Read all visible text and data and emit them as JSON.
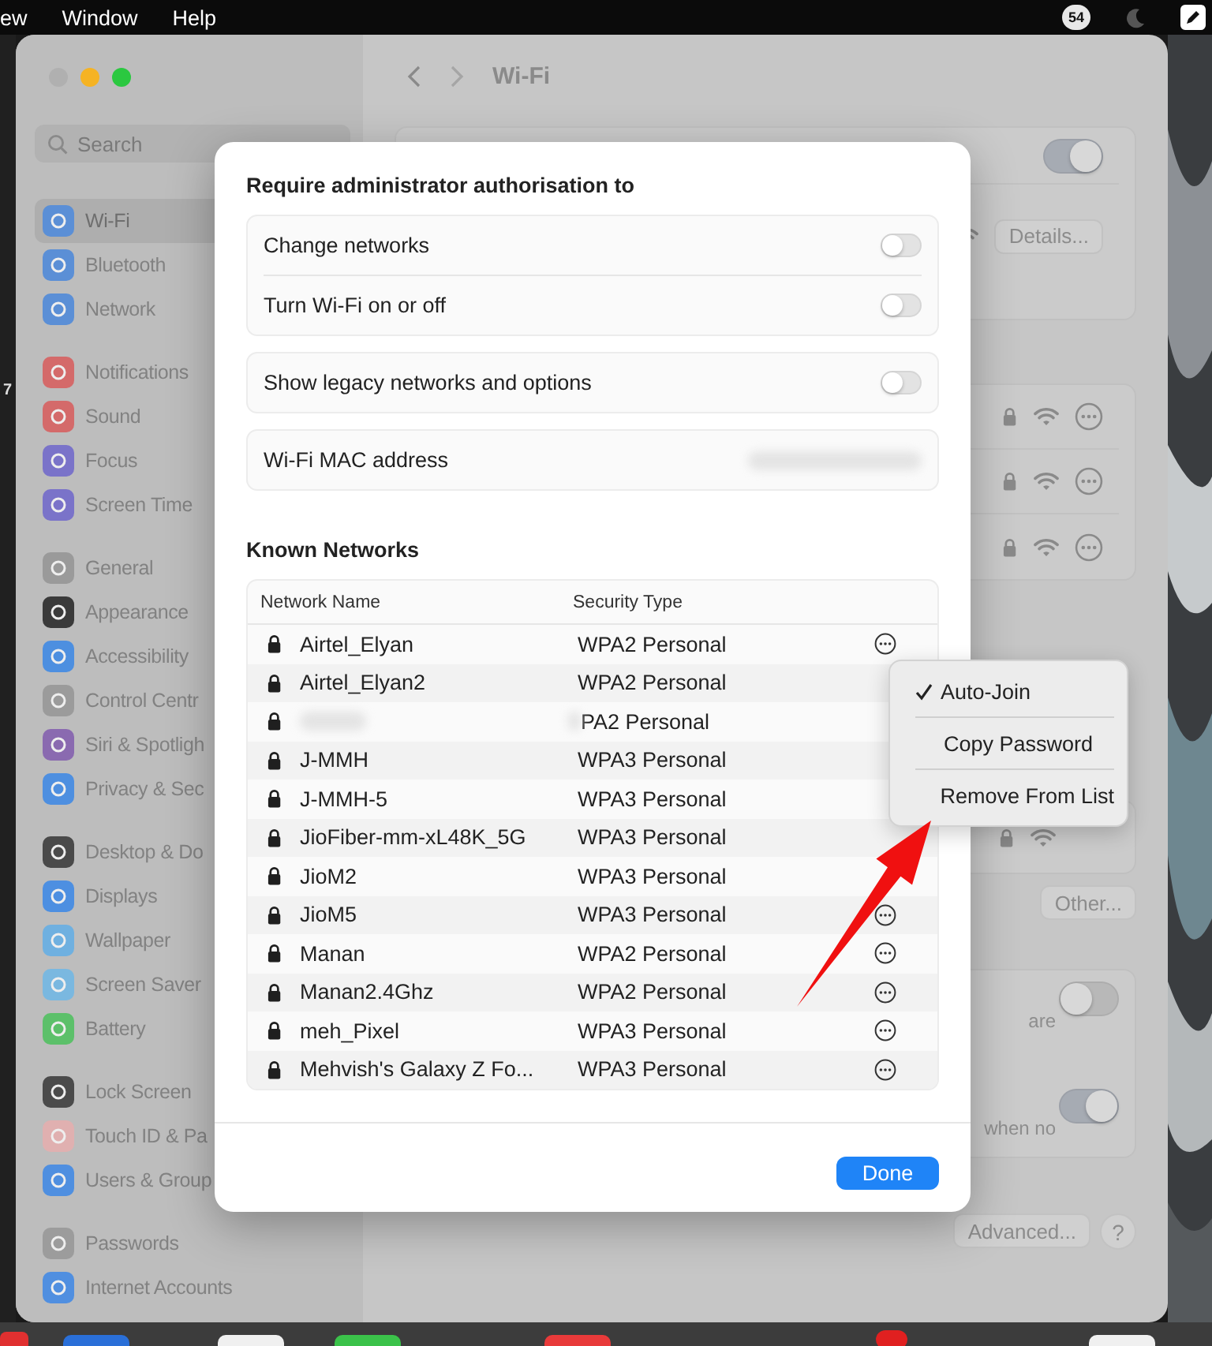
{
  "menu_bar": {
    "items": [
      "ew",
      "Window",
      "Help"
    ],
    "notification_count": "54"
  },
  "desktop": {
    "edge_text": "7"
  },
  "window": {
    "title": "Wi-Fi"
  },
  "sidebar": {
    "search": {
      "placeholder": "Search"
    },
    "groups": [
      {
        "items": [
          {
            "label": "Wi-Fi",
            "selected": true,
            "color": "#5b8fd6"
          },
          {
            "label": "Bluetooth",
            "selected": false,
            "color": "#5b8fd6"
          },
          {
            "label": "Network",
            "selected": false,
            "color": "#5b8fd6"
          }
        ]
      },
      {
        "items": [
          {
            "label": "Notifications",
            "selected": false,
            "color": "#d46a6a"
          },
          {
            "label": "Sound",
            "selected": false,
            "color": "#d46a6a"
          },
          {
            "label": "Focus",
            "selected": false,
            "color": "#7a73c9"
          },
          {
            "label": "Screen Time",
            "selected": false,
            "color": "#7a73c9"
          }
        ]
      },
      {
        "items": [
          {
            "label": "General",
            "selected": false,
            "color": "#9a9a9a"
          },
          {
            "label": "Appearance",
            "selected": false,
            "color": "#3a3a3a"
          },
          {
            "label": "Accessibility",
            "selected": false,
            "color": "#4d8fe0"
          },
          {
            "label": "Control Centr",
            "selected": false,
            "color": "#9b9b9b"
          },
          {
            "label": "Siri & Spotligh",
            "selected": false,
            "color": "#8a6ab0"
          },
          {
            "label": "Privacy & Sec",
            "selected": false,
            "color": "#4e8fe0"
          }
        ]
      },
      {
        "items": [
          {
            "label": "Desktop & Do",
            "selected": false,
            "color": "#4a4a4a"
          },
          {
            "label": "Displays",
            "selected": false,
            "color": "#4d8fe1"
          },
          {
            "label": "Wallpaper",
            "selected": false,
            "color": "#6fb0e0"
          },
          {
            "label": "Screen Saver",
            "selected": false,
            "color": "#7ab8e0"
          },
          {
            "label": "Battery",
            "selected": false,
            "color": "#5cc06a"
          }
        ]
      },
      {
        "items": [
          {
            "label": "Lock Screen",
            "selected": false,
            "color": "#4b4b4b"
          },
          {
            "label": "Touch ID & Pa",
            "selected": false,
            "color": "#e0b0b0"
          },
          {
            "label": "Users & Group",
            "selected": false,
            "color": "#4f8fe0"
          }
        ]
      },
      {
        "items": [
          {
            "label": "Passwords",
            "selected": false,
            "color": "#9c9c9c"
          },
          {
            "label": "Internet Accounts",
            "selected": false,
            "color": "#508fe0"
          }
        ]
      }
    ]
  },
  "main": {
    "wifi_toggle": {
      "on": true
    },
    "details_button": "Details...",
    "network_rows": [
      {
        "locked": true
      },
      {
        "locked": true
      },
      {
        "locked": true
      }
    ],
    "other_row": {
      "locked": true
    },
    "other_button": "Other...",
    "options": [
      {
        "text": "are",
        "on": false
      },
      {
        "text": "when no",
        "on": true
      }
    ],
    "advanced_button": "Advanced...",
    "help_button": "?"
  },
  "dialog": {
    "title": "Require administrator authorisation to",
    "groups": [
      {
        "rows": [
          {
            "kind": "toggle",
            "label": "Change networks",
            "on": false
          },
          {
            "kind": "toggle",
            "label": "Turn Wi-Fi on or off",
            "on": false
          }
        ]
      },
      {
        "rows": [
          {
            "kind": "toggle",
            "label": "Show legacy networks and options",
            "on": false
          }
        ]
      },
      {
        "rows": [
          {
            "kind": "value",
            "label": "Wi-Fi MAC address",
            "redacted": true
          }
        ]
      }
    ],
    "known_title": "Known Networks",
    "columns": [
      "Network Name",
      "Security Type"
    ],
    "networks": [
      {
        "kind": "plain",
        "name": "Airtel_Elyan",
        "security": "WPA2 Personal",
        "more": true
      },
      {
        "kind": "plain",
        "name": "Airtel_Elyan2",
        "security": "WPA2 Personal",
        "more": false
      },
      {
        "kind": "redacted",
        "security": "PA2 Personal",
        "more": false
      },
      {
        "kind": "plain",
        "name": "J-MMH",
        "security": "WPA3 Personal",
        "more": false
      },
      {
        "kind": "plain",
        "name": "J-MMH-5",
        "security": "WPA3 Personal",
        "more": false
      },
      {
        "kind": "plain",
        "name": "JioFiber-mm-xL48K_5G",
        "security": "WPA3 Personal",
        "more": false
      },
      {
        "kind": "plain",
        "name": "JioM2",
        "security": "WPA3 Personal",
        "more": false
      },
      {
        "kind": "plain",
        "name": "JioM5",
        "security": "WPA3 Personal",
        "more": true
      },
      {
        "kind": "plain",
        "name": "Manan",
        "security": "WPA2 Personal",
        "more": true
      },
      {
        "kind": "plain",
        "name": "Manan2.4Ghz",
        "security": "WPA2 Personal",
        "more": true
      },
      {
        "kind": "plain",
        "name": "meh_Pixel",
        "security": "WPA3 Personal",
        "more": true
      },
      {
        "kind": "plain",
        "name": "Mehvish's Galaxy Z Fo...",
        "security": "WPA3 Personal",
        "more": true
      }
    ],
    "done_button": "Done"
  },
  "context_menu": {
    "items": [
      {
        "label": "Auto-Join",
        "checked": true
      },
      {
        "label": "Copy Password",
        "checked": false
      },
      {
        "label": "Remove From List",
        "checked": false
      }
    ]
  }
}
